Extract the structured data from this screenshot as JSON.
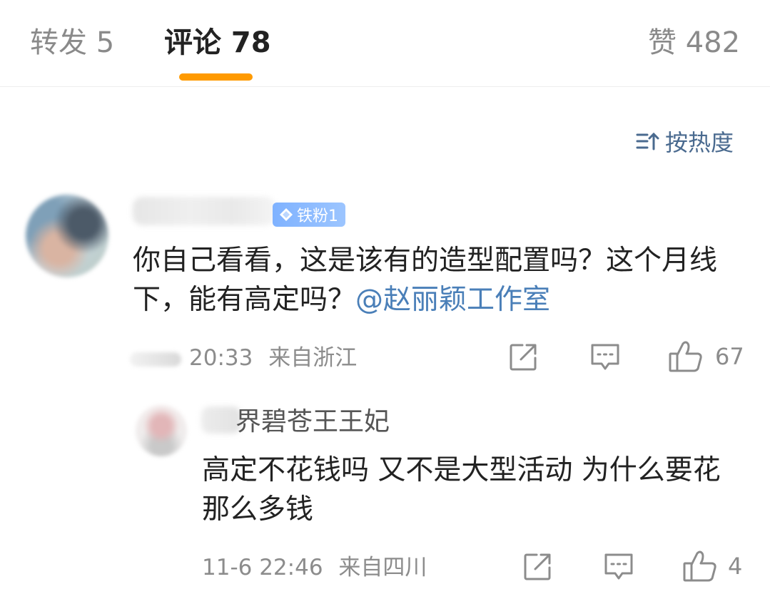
{
  "tabs": {
    "repost": "转发 5",
    "comments": "评论 78",
    "likes": "赞 482"
  },
  "sort": {
    "label": "按热度",
    "icon": "sort-icon"
  },
  "accent_color": "#ff9a00",
  "link_color": "#4a7fb8",
  "comment": {
    "badge": "铁粉1",
    "text": "你自己看看，这是该有的造型配置吗？这个月线下，能有高定吗？",
    "mention": "@赵丽颖工作室",
    "time": "20:33",
    "location": "来自浙江",
    "like_count": "67"
  },
  "reply": {
    "name_visible": "界碧苍王王妃",
    "text": "高定不花钱吗 又不是大型活动 为什么要花那么多钱",
    "time": "11-6 22:46",
    "location": "来自四川",
    "like_count": "4"
  }
}
